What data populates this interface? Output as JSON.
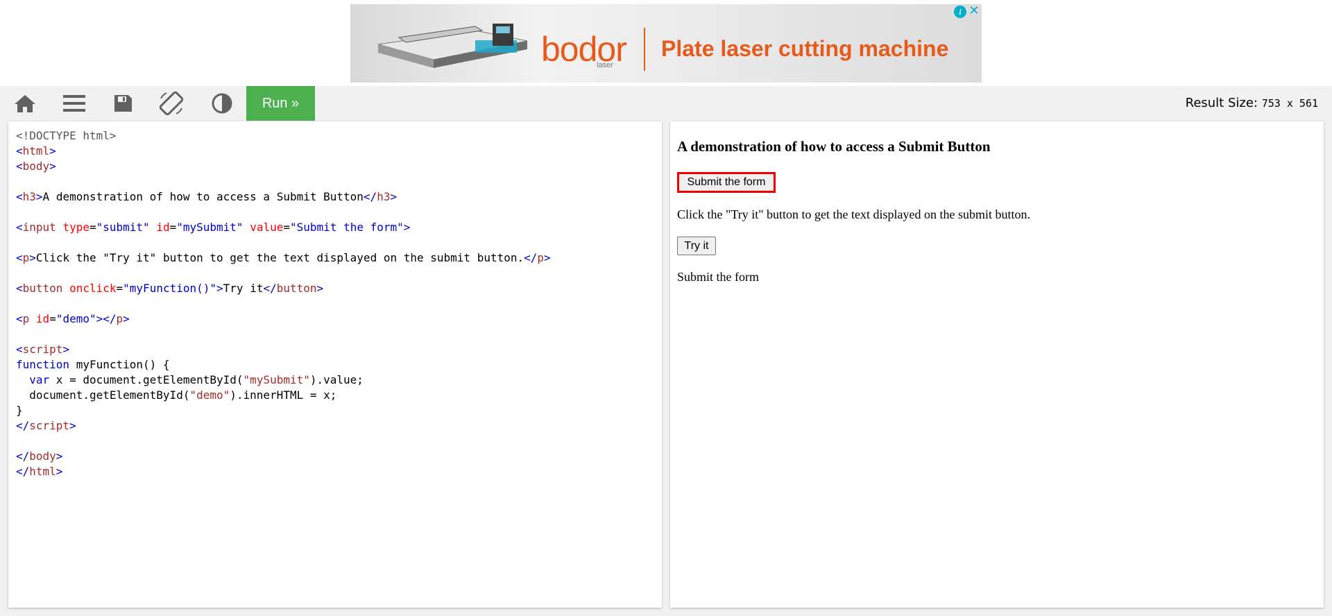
{
  "ad": {
    "logo": "bodor",
    "logo_sub": "laser",
    "headline": "Plate laser cutting machine",
    "info_glyph": "i",
    "close_glyph": "✕"
  },
  "toolbar": {
    "icons": [
      "home-icon",
      "menu-icon",
      "save-icon",
      "rotate-icon",
      "contrast-icon"
    ],
    "run_label": "Run »",
    "result_size_label": "Result Size:",
    "result_size_value": "753 x 561"
  },
  "code": {
    "lines": [
      [
        {
          "c": "doc",
          "t": "<!DOCTYPE html>"
        }
      ],
      [
        {
          "c": "br",
          "t": "<"
        },
        {
          "c": "tag",
          "t": "html"
        },
        {
          "c": "br",
          "t": ">"
        }
      ],
      [
        {
          "c": "br",
          "t": "<"
        },
        {
          "c": "tag",
          "t": "body"
        },
        {
          "c": "br",
          "t": ">"
        }
      ],
      [],
      [
        {
          "c": "br",
          "t": "<"
        },
        {
          "c": "tag",
          "t": "h3"
        },
        {
          "c": "br",
          "t": ">"
        },
        {
          "c": "txt",
          "t": "A demonstration of how to access a Submit Button"
        },
        {
          "c": "br",
          "t": "</"
        },
        {
          "c": "tag",
          "t": "h3"
        },
        {
          "c": "br",
          "t": ">"
        }
      ],
      [],
      [
        {
          "c": "br",
          "t": "<"
        },
        {
          "c": "tag",
          "t": "input"
        },
        {
          "c": "txt",
          "t": " "
        },
        {
          "c": "attr",
          "t": "type"
        },
        {
          "c": "txt",
          "t": "="
        },
        {
          "c": "val",
          "t": "\"submit\""
        },
        {
          "c": "txt",
          "t": " "
        },
        {
          "c": "attr",
          "t": "id"
        },
        {
          "c": "txt",
          "t": "="
        },
        {
          "c": "val",
          "t": "\"mySubmit\""
        },
        {
          "c": "txt",
          "t": " "
        },
        {
          "c": "attr",
          "t": "value"
        },
        {
          "c": "txt",
          "t": "="
        },
        {
          "c": "val",
          "t": "\"Submit the form\""
        },
        {
          "c": "br",
          "t": ">"
        }
      ],
      [],
      [
        {
          "c": "br",
          "t": "<"
        },
        {
          "c": "tag",
          "t": "p"
        },
        {
          "c": "br",
          "t": ">"
        },
        {
          "c": "txt",
          "t": "Click the \"Try it\" button to get the text displayed on the submit button."
        },
        {
          "c": "br",
          "t": "</"
        },
        {
          "c": "tag",
          "t": "p"
        },
        {
          "c": "br",
          "t": ">"
        }
      ],
      [],
      [
        {
          "c": "br",
          "t": "<"
        },
        {
          "c": "tag",
          "t": "button"
        },
        {
          "c": "txt",
          "t": " "
        },
        {
          "c": "attr",
          "t": "onclick"
        },
        {
          "c": "txt",
          "t": "="
        },
        {
          "c": "val",
          "t": "\"myFunction()\""
        },
        {
          "c": "br",
          "t": ">"
        },
        {
          "c": "txt",
          "t": "Try it"
        },
        {
          "c": "br",
          "t": "</"
        },
        {
          "c": "tag",
          "t": "button"
        },
        {
          "c": "br",
          "t": ">"
        }
      ],
      [],
      [
        {
          "c": "br",
          "t": "<"
        },
        {
          "c": "tag",
          "t": "p"
        },
        {
          "c": "txt",
          "t": " "
        },
        {
          "c": "attr",
          "t": "id"
        },
        {
          "c": "txt",
          "t": "="
        },
        {
          "c": "val",
          "t": "\"demo\""
        },
        {
          "c": "br",
          "t": "></"
        },
        {
          "c": "tag",
          "t": "p"
        },
        {
          "c": "br",
          "t": ">"
        }
      ],
      [],
      [
        {
          "c": "br",
          "t": "<"
        },
        {
          "c": "tag",
          "t": "script"
        },
        {
          "c": "br",
          "t": ">"
        }
      ],
      [
        {
          "c": "kw",
          "t": "function"
        },
        {
          "c": "txt",
          "t": " myFunction() {"
        }
      ],
      [
        {
          "c": "txt",
          "t": "  "
        },
        {
          "c": "kw",
          "t": "var"
        },
        {
          "c": "txt",
          "t": " x = document.getElementById("
        },
        {
          "c": "str",
          "t": "\"mySubmit\""
        },
        {
          "c": "txt",
          "t": ").value;"
        }
      ],
      [
        {
          "c": "txt",
          "t": "  document.getElementById("
        },
        {
          "c": "str",
          "t": "\"demo\""
        },
        {
          "c": "txt",
          "t": ").innerHTML = x;"
        }
      ],
      [
        {
          "c": "txt",
          "t": "}"
        }
      ],
      [
        {
          "c": "br",
          "t": "</"
        },
        {
          "c": "tag",
          "t": "script"
        },
        {
          "c": "br",
          "t": ">"
        }
      ],
      [],
      [
        {
          "c": "br",
          "t": "</"
        },
        {
          "c": "tag",
          "t": "body"
        },
        {
          "c": "br",
          "t": ">"
        }
      ],
      [
        {
          "c": "br",
          "t": "</"
        },
        {
          "c": "tag",
          "t": "html"
        },
        {
          "c": "br",
          "t": ">"
        }
      ]
    ]
  },
  "result": {
    "heading": "A demonstration of how to access a Submit Button",
    "submit_label": "Submit the form",
    "paragraph": "Click the \"Try it\" button to get the text displayed on the submit button.",
    "try_label": "Try it",
    "demo_text": "Submit the form"
  },
  "colors": {
    "run_green": "#4caf50",
    "toolbar_bg": "#f1f1f1",
    "ad_orange": "#e85a1a",
    "highlight_red": "#ee0000"
  }
}
